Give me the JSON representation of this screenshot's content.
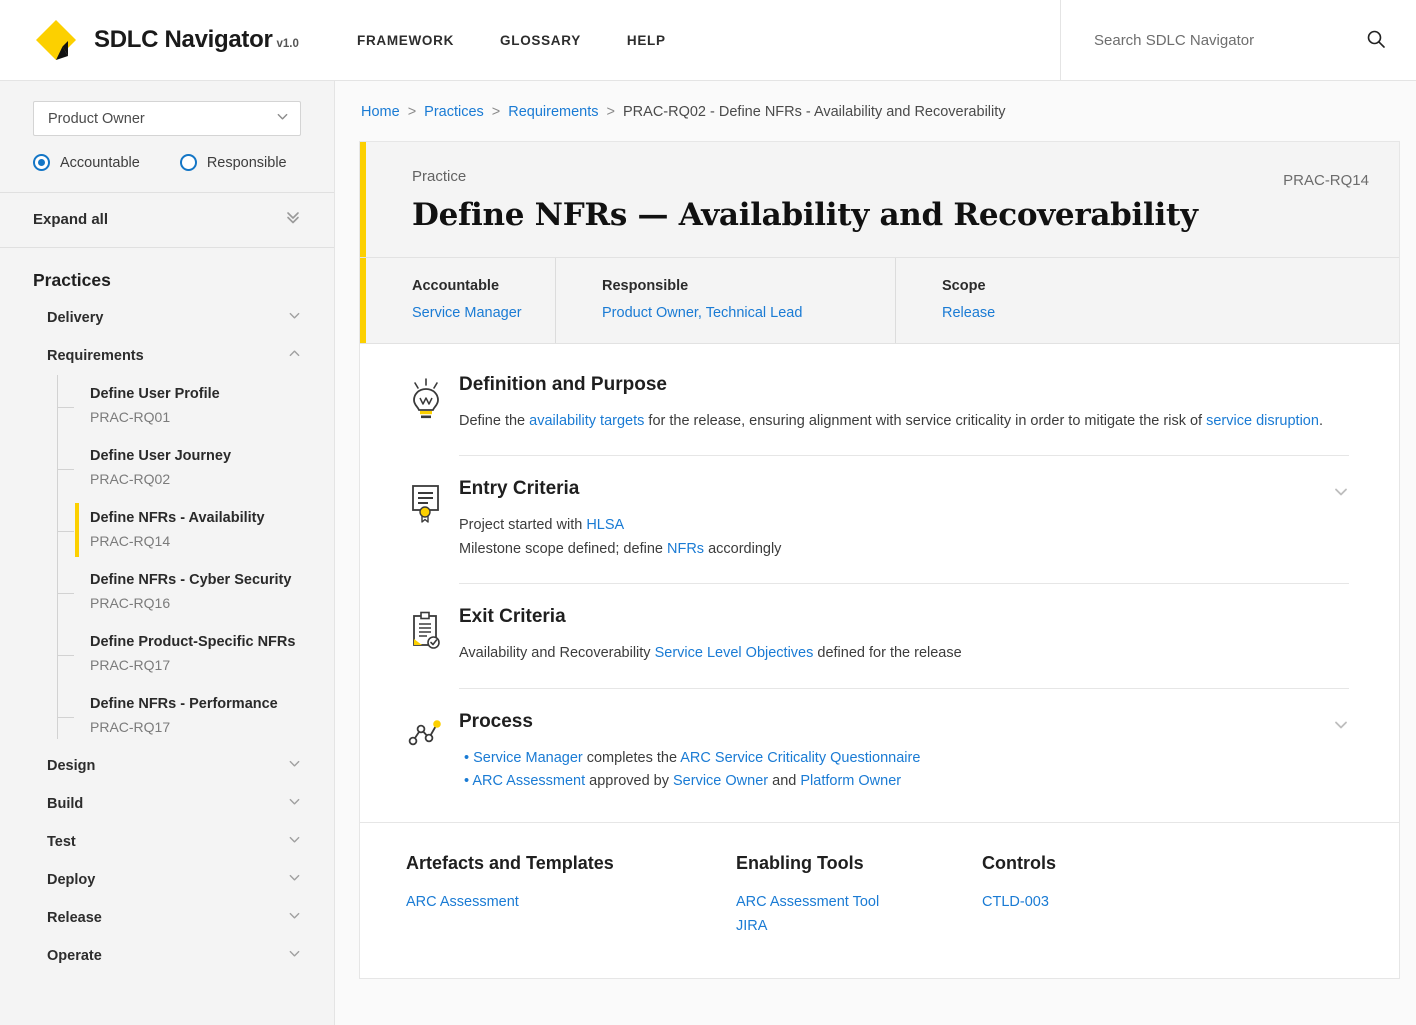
{
  "brand": {
    "name": "SDLC Navigator",
    "version": "v1.0",
    "logo_color": "#FCD000"
  },
  "nav": {
    "items": [
      {
        "label": "FRAMEWORK"
      },
      {
        "label": "GLOSSARY"
      },
      {
        "label": "HELP"
      }
    ]
  },
  "search": {
    "placeholder": "Search SDLC Navigator",
    "value": "",
    "icon": "search-icon"
  },
  "sidebar": {
    "role": {
      "value": "Product Owner",
      "icon": "chevron-down-icon"
    },
    "raci": {
      "accountable": "Accountable",
      "responsible": "Responsible",
      "selected": "Accountable"
    },
    "expand_all": {
      "label": "Expand all",
      "icon": "double-chevron-down-icon"
    },
    "section_title": "Practices",
    "groups": [
      {
        "label": "Delivery",
        "expanded": false
      },
      {
        "label": "Requirements",
        "expanded": true,
        "items": [
          {
            "title": "Define User Profile",
            "code": "PRAC-RQ01",
            "active": false
          },
          {
            "title": "Define User Journey",
            "code": "PRAC-RQ02",
            "active": false
          },
          {
            "title": "Define NFRs - Availability",
            "code": "PRAC-RQ14",
            "active": true
          },
          {
            "title": "Define NFRs - Cyber Security",
            "code": "PRAC-RQ16",
            "active": false
          },
          {
            "title": "Define Product-Specific NFRs",
            "code": "PRAC-RQ17",
            "active": false
          },
          {
            "title": "Define NFRs - Performance",
            "code": "PRAC-RQ17",
            "active": false
          }
        ]
      },
      {
        "label": "Design",
        "expanded": false
      },
      {
        "label": "Build",
        "expanded": false
      },
      {
        "label": "Test",
        "expanded": false
      },
      {
        "label": "Deploy",
        "expanded": false
      },
      {
        "label": "Release",
        "expanded": false
      },
      {
        "label": "Operate",
        "expanded": false
      }
    ]
  },
  "breadcrumb": {
    "home": "Home",
    "practices": "Practices",
    "requirements": "Requirements",
    "current": "PRAC-RQ02 - Define NFRs - Availability and Recoverability",
    "sep": ">"
  },
  "hero": {
    "kicker": "Practice",
    "title": "Define NFRs — Availability and Recoverability",
    "code": "PRAC-RQ14",
    "accent": "#FCD000"
  },
  "meta": {
    "accountable": {
      "label": "Accountable",
      "value": "Service Manager"
    },
    "responsible": {
      "label": "Responsible",
      "value": "Product Owner, Technical Lead"
    },
    "scope": {
      "label": "Scope",
      "value": "Release"
    }
  },
  "sections": {
    "definition": {
      "icon": "lightbulb-icon",
      "heading": "Definition and Purpose",
      "text_1": "Define the ",
      "link_1": "availability targets",
      "text_2": " for the release, ensuring alignment with service criticality in order to mitigate the risk of ",
      "link_2": "service disruption",
      "text_3": "."
    },
    "entry": {
      "icon": "certificate-icon",
      "heading": "Entry Criteria",
      "chevron": "chevron-down-icon",
      "line1_a": "Project started with ",
      "line1_link": "HLSA",
      "line2_a": "Milestone scope defined; define ",
      "line2_link": "NFRs",
      "line2_b": " accordingly"
    },
    "exit": {
      "icon": "clipboard-check-icon",
      "heading": "Exit Criteria",
      "line_a": "Availability and Recoverability ",
      "line_link": "Service Level Objectives",
      "line_b": " defined for the release"
    },
    "process": {
      "icon": "node-graph-icon",
      "heading": "Process",
      "chevron": "chevron-down-icon",
      "b1_bullet": "•",
      "b1_link1": "Service Manager",
      "b1_mid": " completes the ",
      "b1_link2": "ARC Service Criticality Questionnaire",
      "b2_bullet": "•",
      "b2_link1": "ARC Assessment",
      "b2_mid": " approved by ",
      "b2_link2": "Service Owner",
      "b2_and": " and ",
      "b2_link3": "Platform Owner"
    }
  },
  "footer": {
    "artefacts": {
      "heading": "Artefacts and Templates",
      "items": [
        "ARC Assessment"
      ]
    },
    "tools": {
      "heading": "Enabling Tools",
      "items": [
        "ARC Assessment Tool",
        "JIRA"
      ]
    },
    "controls": {
      "heading": "Controls",
      "items": [
        "CTLD-003"
      ]
    }
  }
}
